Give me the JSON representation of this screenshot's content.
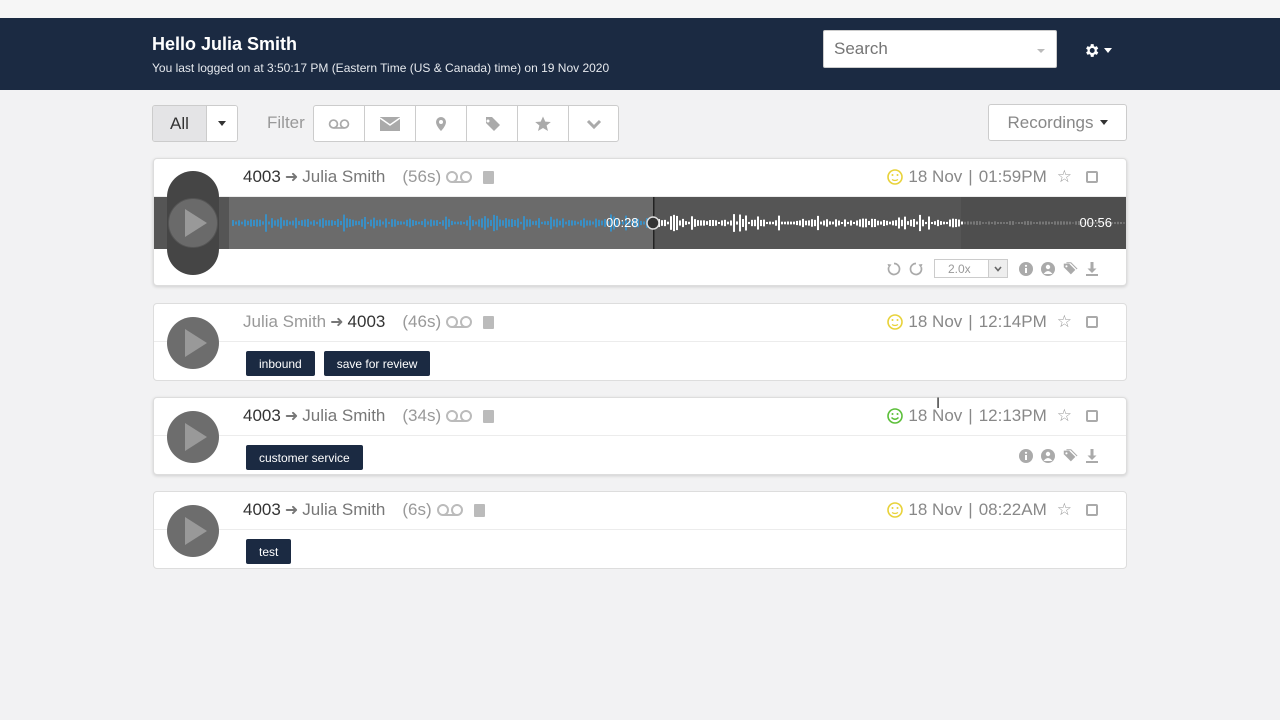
{
  "header": {
    "greeting": "Hello Julia Smith",
    "last_login": "You last logged on at 3:50:17 PM (Eastern Time (US & Canada) time) on 19 Nov 2020",
    "search_placeholder": "Search",
    "settings_icon": "gear-icon"
  },
  "toolbar": {
    "all_label": "All",
    "filter_label": "Filter",
    "filter_icons": [
      "voicemail-icon",
      "envelope-icon",
      "map-marker-icon",
      "tag-icon",
      "star-icon",
      "chevron-down-icon"
    ],
    "recordings_label": "Recordings"
  },
  "calls": [
    {
      "from": "4003",
      "to": "Julia Smith",
      "duration": "(56s)",
      "date": "18 Nov",
      "time": "01:59PM",
      "sentiment": "neutral",
      "sentiment_color": "#e8d23a",
      "tags": [],
      "playing": true,
      "current_time": "00:28",
      "total_time": "00:56",
      "speed": "2.0x"
    },
    {
      "from": "Julia Smith",
      "to": "4003",
      "duration": "(46s)",
      "date": "18 Nov",
      "time": "12:14PM",
      "sentiment": "neutral",
      "sentiment_color": "#e8d23a",
      "tags": [
        "inbound",
        "save for review"
      ]
    },
    {
      "from": "4003",
      "to": "Julia Smith",
      "duration": "(34s)",
      "date": "18 Nov",
      "time": "12:13PM",
      "sentiment": "positive",
      "sentiment_color": "#5cbf3a",
      "tags": [
        "customer service"
      ]
    },
    {
      "from": "4003",
      "to": "Julia Smith",
      "duration": "(6s)",
      "date": "18 Nov",
      "time": "08:22AM",
      "sentiment": "neutral",
      "sentiment_color": "#e8d23a",
      "tags": [
        "test"
      ]
    }
  ],
  "separator": "|",
  "colors": {
    "header_bg": "#1b2a42",
    "tag_bg": "#1b2a42",
    "wave_played": "#3a8fc4"
  }
}
